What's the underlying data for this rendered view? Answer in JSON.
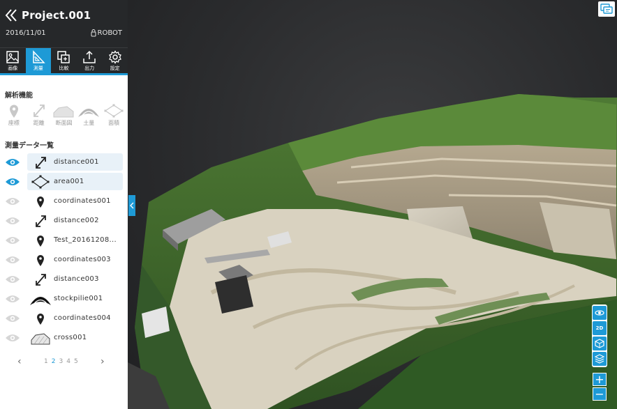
{
  "header": {
    "title": "Project.001",
    "date": "2016/11/01",
    "owner": "ROBOT"
  },
  "toolbar": [
    {
      "label": "画像",
      "icon": "image-icon"
    },
    {
      "label": "測量",
      "icon": "triangle-ruler-icon",
      "active": true
    },
    {
      "label": "比較",
      "icon": "compare-icon"
    },
    {
      "label": "出力",
      "icon": "export-icon"
    },
    {
      "label": "設定",
      "icon": "gear-icon"
    }
  ],
  "analysis": {
    "title": "解析機能",
    "items": [
      {
        "label": "座標",
        "icon": "pin-icon"
      },
      {
        "label": "距離",
        "icon": "distance-icon"
      },
      {
        "label": "断面図",
        "icon": "cross-section-icon"
      },
      {
        "label": "土量",
        "icon": "volume-icon"
      },
      {
        "label": "面積",
        "icon": "area-icon"
      }
    ]
  },
  "data_list": {
    "title": "測量データ一覧",
    "items": [
      {
        "label": "distance001",
        "icon": "distance-icon",
        "visible": true
      },
      {
        "label": "area001",
        "icon": "area-icon",
        "visible": true
      },
      {
        "label": "coordinates001",
        "icon": "pin-icon",
        "visible": false
      },
      {
        "label": "distance002",
        "icon": "distance-icon",
        "visible": false
      },
      {
        "label": "Test_20161208...",
        "icon": "pin-icon",
        "visible": false
      },
      {
        "label": "coordinates003",
        "icon": "pin-icon",
        "visible": false
      },
      {
        "label": "distance003",
        "icon": "distance-icon",
        "visible": false
      },
      {
        "label": "stockpilie001",
        "icon": "stockpile-icon",
        "visible": false
      },
      {
        "label": "coordinates004",
        "icon": "pin-icon",
        "visible": false
      },
      {
        "label": "cross001",
        "icon": "cross-section-icon",
        "visible": false
      }
    ]
  },
  "pagination": {
    "pages": [
      "1",
      "2",
      "3",
      "4",
      "5"
    ],
    "current": "2"
  },
  "view_controls": {
    "mode_2d": "2D",
    "mode_3d": "3D"
  },
  "zoom": {
    "in": "+",
    "out": "−"
  },
  "colors": {
    "accent": "#1e9ad6",
    "header_bg": "#26282a"
  }
}
